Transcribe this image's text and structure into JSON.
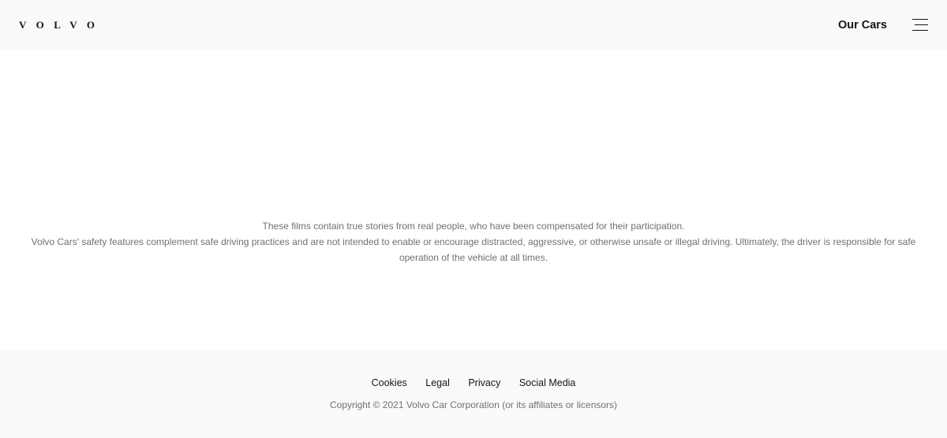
{
  "header": {
    "logo_text": "VOLVO",
    "nav_label": "Our Cars",
    "menu_icon": "hamburger-menu-icon"
  },
  "disclaimer": {
    "line1": "These films contain true stories from real people, who have been compensated for their participation.",
    "line2": "Volvo Cars' safety features complement safe driving practices and are not intended to enable or encourage distracted, aggressive, or otherwise unsafe or illegal driving. Ultimately, the driver is responsible for safe operation of the vehicle at all times."
  },
  "footer": {
    "links": [
      "Cookies",
      "Legal",
      "Privacy",
      "Social Media"
    ],
    "copyright": "Copyright © 2021 Volvo Car Corporation (or its affiliates or licensors)"
  },
  "colors": {
    "header_bg": "#fafafa",
    "footer_bg": "#fafafa",
    "text_primary": "#141414",
    "text_secondary": "#707070"
  }
}
